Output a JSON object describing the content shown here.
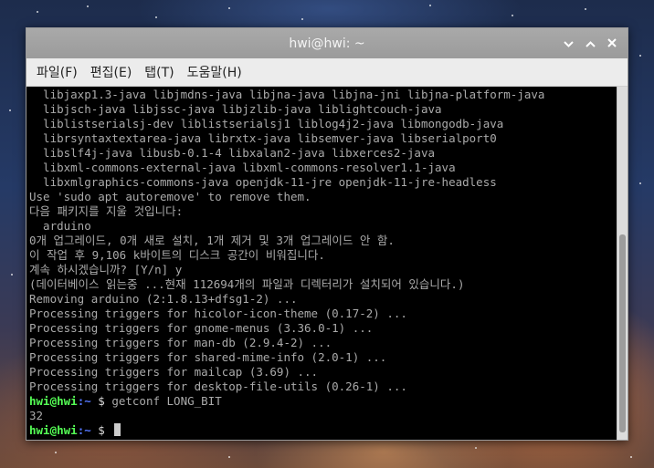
{
  "window": {
    "title": "hwi@hwi: ~",
    "controls": {
      "minimize": "⌄",
      "maximize": "⌃",
      "close": "✕"
    }
  },
  "menu": [
    "파일(F)",
    "편집(E)",
    "탭(T)",
    "도움말(H)"
  ],
  "terminal": {
    "lines": [
      "  libjaxp1.3-java libjmdns-java libjna-java libjna-jni libjna-platform-java",
      "  libjsch-java libjssc-java libjzlib-java liblightcouch-java",
      "  liblistserialsj-dev liblistserialsj1 liblog4j2-java libmongodb-java",
      "  librsyntaxtextarea-java librxtx-java libsemver-java libserialport0",
      "  libslf4j-java libusb-0.1-4 libxalan2-java libxerces2-java",
      "  libxml-commons-external-java libxml-commons-resolver1.1-java",
      "  libxmlgraphics-commons-java openjdk-11-jre openjdk-11-jre-headless",
      "Use 'sudo apt autoremove' to remove them.",
      "다음 패키지를 지울 것입니다:",
      "  arduino",
      "0개 업그레이드, 0개 새로 설치, 1개 제거 및 3개 업그레이드 안 함.",
      "이 작업 후 9,106 k바이트의 디스크 공간이 비워집니다.",
      "계속 하시겠습니까? [Y/n] y",
      "(데이터베이스 읽는중 ...현재 112694개의 파일과 디렉터리가 설치되어 있습니다.)",
      "Removing arduino (2:1.8.13+dfsg1-2) ...",
      "Processing triggers for hicolor-icon-theme (0.17-2) ...",
      "Processing triggers for gnome-menus (3.36.0-1) ...",
      "Processing triggers for man-db (2.9.4-2) ...",
      "Processing triggers for shared-mime-info (2.0-1) ...",
      "Processing triggers for mailcap (3.69) ...",
      "Processing triggers for desktop-file-utils (0.26-1) ..."
    ],
    "prompt_user": "hwi@hwi",
    "prompt_path": ":~",
    "prompt_symbol": " $ ",
    "command": "getconf LONG_BIT",
    "output": "32"
  },
  "colors": {
    "prompt_user": "#55ff55",
    "prompt_path": "#5577ff",
    "text": "#aaaaaa",
    "background": "#000000"
  }
}
